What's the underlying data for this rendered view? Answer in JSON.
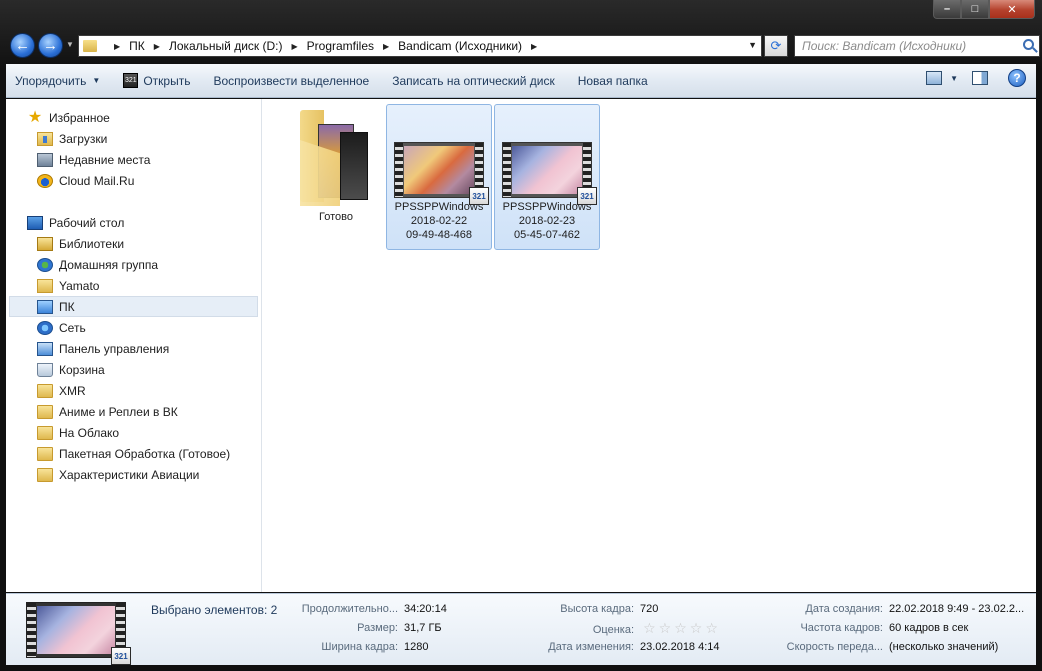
{
  "window": {
    "minimize_label": "–",
    "maximize_label": "□",
    "close_label": "✕"
  },
  "nav": {
    "back_glyph": "←",
    "forward_glyph": "→",
    "breadcrumbs": [
      "ПК",
      "Локальный диск (D:)",
      "Programfiles",
      "Bandicam (Исходники)"
    ],
    "refresh_glyph": "⟳",
    "search_placeholder": "Поиск: Bandicam (Исходники)"
  },
  "toolbar": {
    "organize": "Упорядочить",
    "open": "Открыть",
    "play_selected": "Воспроизвести выделенное",
    "burn": "Записать на оптический диск",
    "new_folder": "Новая папка",
    "help_glyph": "?"
  },
  "sidebar": {
    "favorites": "Избранное",
    "favorites_items": [
      "Загрузки",
      "Недавние места",
      "Cloud Mail.Ru"
    ],
    "desktop": "Рабочий стол",
    "desktop_items": [
      "Библиотеки",
      "Домашняя группа",
      "Yamato",
      "ПК",
      "Сеть",
      "Панель управления",
      "Корзина",
      "XMR",
      "Аниме и Реплеи в ВК",
      "На Облако",
      "Пакетная Обработка (Готовое)",
      "Характеристики Авиации"
    ]
  },
  "files": [
    {
      "name_lines": [
        "Готово"
      ],
      "type": "folder",
      "selected": false
    },
    {
      "name_lines": [
        "PPSSPPWindows",
        "2018-02-22",
        "09-49-48-468"
      ],
      "type": "video",
      "selected": true,
      "badge": "321"
    },
    {
      "name_lines": [
        "PPSSPPWindows",
        "2018-02-23",
        "05-45-07-462"
      ],
      "type": "video",
      "selected": true,
      "badge": "321"
    }
  ],
  "details": {
    "title": "Выбрано элементов: 2",
    "duration_key": "Продолжительно...",
    "duration_val": "34:20:14",
    "size_key": "Размер:",
    "size_val": "31,7 ГБ",
    "width_key": "Ширина кадра:",
    "width_val": "1280",
    "height_key": "Высота кадра:",
    "height_val": "720",
    "rating_key": "Оценка:",
    "rating_stars": 0,
    "modified_key": "Дата изменения:",
    "modified_val": "23.02.2018 4:14",
    "created_key": "Дата создания:",
    "created_val": "22.02.2018 9:49 - 23.02.2...",
    "framerate_key": "Частота кадров:",
    "framerate_val": "60 кадров в сек",
    "speed_key": "Скорость переда...",
    "speed_val": "(несколько значений)",
    "badge": "321"
  }
}
